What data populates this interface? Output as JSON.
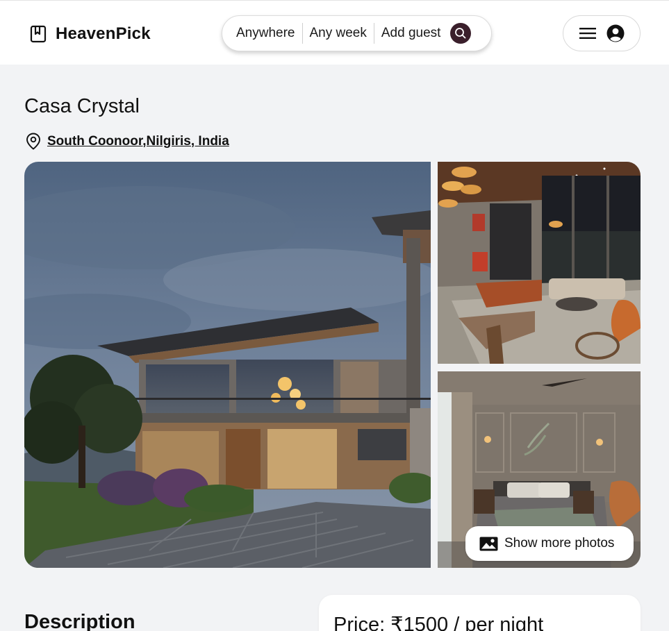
{
  "brand": {
    "name": "HeavenPick",
    "icon": "bookmark-icon"
  },
  "search": {
    "location": "Anywhere",
    "date": "Any week",
    "guests": "Add guest",
    "button_icon": "search-icon",
    "button_color": "#3a1f2b"
  },
  "user_menu": {
    "menu_icon": "hamburger-icon",
    "avatar_icon": "user-circle-icon"
  },
  "listing": {
    "title": "Casa Crystal",
    "location": "South Coonoor,Nilgiris, India",
    "location_icon": "map-pin-icon"
  },
  "gallery": {
    "photos": [
      {
        "name": "villa-exterior-photo"
      },
      {
        "name": "living-room-photo"
      },
      {
        "name": "bedroom-photo"
      }
    ],
    "show_more_label": "Show more photos",
    "show_more_icon": "image-icon"
  },
  "description": {
    "heading": "Description"
  },
  "pricing": {
    "label": "Price: ₹1500 / per night"
  },
  "colors": {
    "page_bg": "#f2f3f5",
    "header_bg": "#ffffff",
    "accent": "#3a1f2b"
  }
}
